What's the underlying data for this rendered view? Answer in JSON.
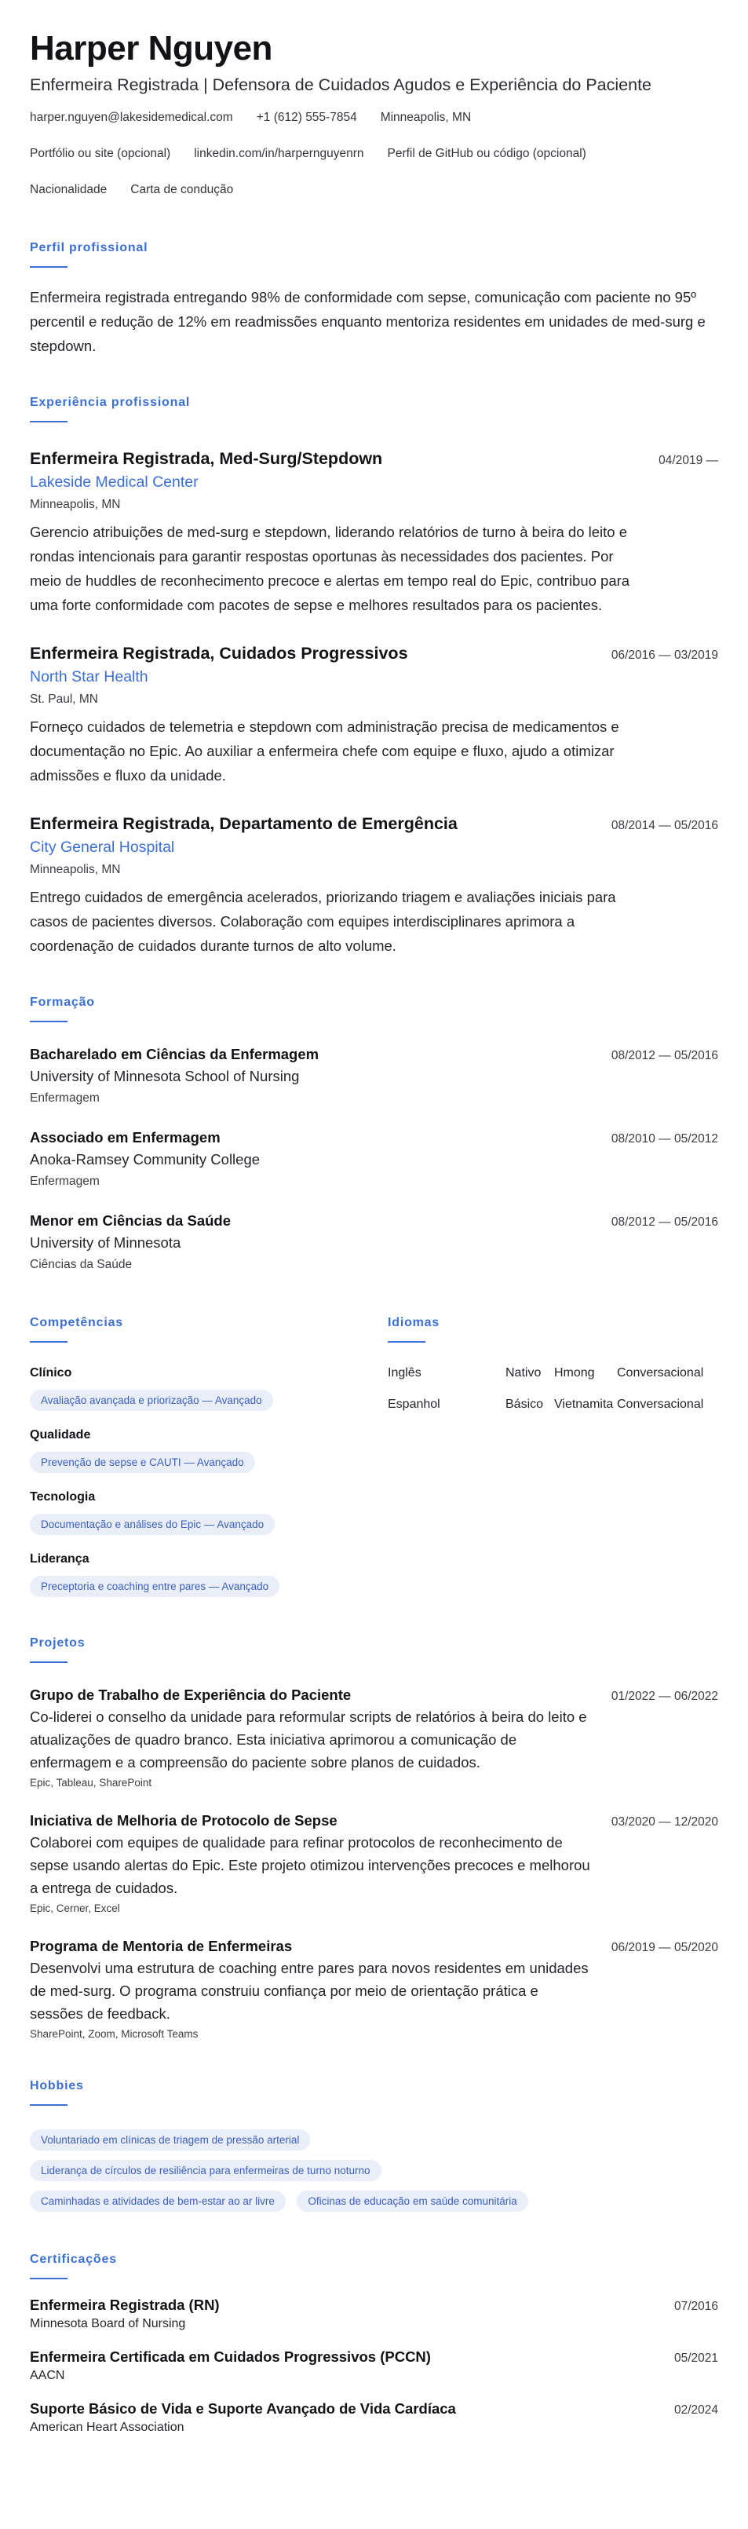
{
  "header": {
    "name": "Harper Nguyen",
    "headline": "Enfermeira Registrada | Defensora de Cuidados Agudos e Experiência do Paciente",
    "contacts": {
      "email": "harper.nguyen@lakesidemedical.com",
      "phone": "+1 (612) 555-7854",
      "location": "Minneapolis, MN",
      "portfolio": "Portfólio ou site (opcional)",
      "linkedin": "linkedin.com/in/harpernguyenrn",
      "github": "Perfil de GitHub ou código (opcional)",
      "nationality": "Nacionalidade",
      "license": "Carta de condução"
    }
  },
  "summary": {
    "title": "Perfil profissional",
    "text": "Enfermeira registrada entregando 98% de conformidade com sepse, comunicação com paciente no 95º percentil e redução de 12% em readmissões enquanto mentoriza residentes em unidades de med-surg e stepdown."
  },
  "experience": {
    "title": "Experiência profissional",
    "jobs": [
      {
        "title": "Enfermeira Registrada, Med-Surg/Stepdown",
        "date": "04/2019 —",
        "employer": "Lakeside Medical Center",
        "location": "Minneapolis, MN",
        "description": "Gerencio atribuições de med-surg e stepdown, liderando relatórios de turno à beira do leito e rondas intencionais para garantir respostas oportunas às necessidades dos pacientes. Por meio de huddles de reconhecimento precoce e alertas em tempo real do Epic, contribuo para uma forte conformidade com pacotes de sepse e melhores resultados para os pacientes."
      },
      {
        "title": "Enfermeira Registrada, Cuidados Progressivos",
        "date": "06/2016 — 03/2019",
        "employer": "North Star Health",
        "location": "St. Paul, MN",
        "description": "Forneço cuidados de telemetria e stepdown com administração precisa de medicamentos e documentação no Epic. Ao auxiliar a enfermeira chefe com equipe e fluxo, ajudo a otimizar admissões e fluxo da unidade."
      },
      {
        "title": "Enfermeira Registrada, Departamento de Emergência",
        "date": "08/2014 — 05/2016",
        "employer": "City General Hospital",
        "location": "Minneapolis, MN",
        "description": "Entrego cuidados de emergência acelerados, priorizando triagem e avaliações iniciais para casos de pacientes diversos. Colaboração com equipes interdisciplinares aprimora a coordenação de cuidados durante turnos de alto volume."
      }
    ]
  },
  "education": {
    "title": "Formação",
    "items": [
      {
        "degree": "Bacharelado em Ciências da Enfermagem",
        "date": "08/2012 — 05/2016",
        "school": "University of Minnesota School of Nursing",
        "field": "Enfermagem"
      },
      {
        "degree": "Associado em Enfermagem",
        "date": "08/2010 — 05/2012",
        "school": "Anoka-Ramsey Community College",
        "field": "Enfermagem"
      },
      {
        "degree": "Menor em Ciências da Saúde",
        "date": "08/2012 — 05/2016",
        "school": "University of Minnesota",
        "field": "Ciências da Saúde"
      }
    ]
  },
  "skills": {
    "title": "Competências",
    "categories": [
      {
        "name": "Clínico",
        "pill": "Avaliação avançada e priorização — Avançado"
      },
      {
        "name": "Qualidade",
        "pill": "Prevenção de sepse e CAUTI — Avançado"
      },
      {
        "name": "Tecnologia",
        "pill": "Documentação e análises do Epic — Avançado"
      },
      {
        "name": "Liderança",
        "pill": "Preceptoria e coaching entre pares — Avançado"
      }
    ]
  },
  "languages": {
    "title": "Idiomas",
    "rows": [
      {
        "lang1": "Inglês",
        "level1": "Nativo",
        "lang2": "Hmong",
        "level2": "Conversacional"
      },
      {
        "lang1": "Espanhol",
        "level1": "Básico",
        "lang2": "Vietnamita",
        "level2": "Conversacional"
      }
    ]
  },
  "projects": {
    "title": "Projetos",
    "items": [
      {
        "title": "Grupo de Trabalho de Experiência do Paciente",
        "date": "01/2022 — 06/2022",
        "description": "Co-liderei o conselho da unidade para reformular scripts de relatórios à beira do leito e atualizações de quadro branco. Esta iniciativa aprimorou a comunicação de enfermagem e a compreensão do paciente sobre planos de cuidados.",
        "tech": "Epic, Tableau, SharePoint"
      },
      {
        "title": "Iniciativa de Melhoria de Protocolo de Sepse",
        "date": "03/2020 — 12/2020",
        "description": "Colaborei com equipes de qualidade para refinar protocolos de reconhecimento de sepse usando alertas do Epic. Este projeto otimizou intervenções precoces e melhorou a entrega de cuidados.",
        "tech": "Epic, Cerner, Excel"
      },
      {
        "title": "Programa de Mentoria de Enfermeiras",
        "date": "06/2019 — 05/2020",
        "description": "Desenvolvi uma estrutura de coaching entre pares para novos residentes em unidades de med-surg. O programa construiu confiança por meio de orientação prática e sessões de feedback.",
        "tech": "SharePoint, Zoom, Microsoft Teams"
      }
    ]
  },
  "hobbies": {
    "title": "Hobbies",
    "items": [
      "Voluntariado em clínicas de triagem de pressão arterial",
      "Liderança de círculos de resiliência para enfermeiras de turno noturno",
      "Caminhadas e atividades de bem-estar ao ar livre",
      "Oficinas de educação em saúde comunitária"
    ]
  },
  "certifications": {
    "title": "Certificações",
    "items": [
      {
        "name": "Enfermeira Registrada (RN)",
        "date": "07/2016",
        "issuer": "Minnesota Board of Nursing"
      },
      {
        "name": "Enfermeira Certificada em Cuidados Progressivos (PCCN)",
        "date": "05/2021",
        "issuer": "AACN"
      },
      {
        "name": "Suporte Básico de Vida e Suporte Avançado de Vida Cardíaca",
        "date": "02/2024",
        "issuer": "American Heart Association"
      }
    ]
  },
  "colors": {
    "accent": "#3a6fd6",
    "pill_bg": "#e9eef8",
    "pill_text": "#3a5fbf"
  }
}
